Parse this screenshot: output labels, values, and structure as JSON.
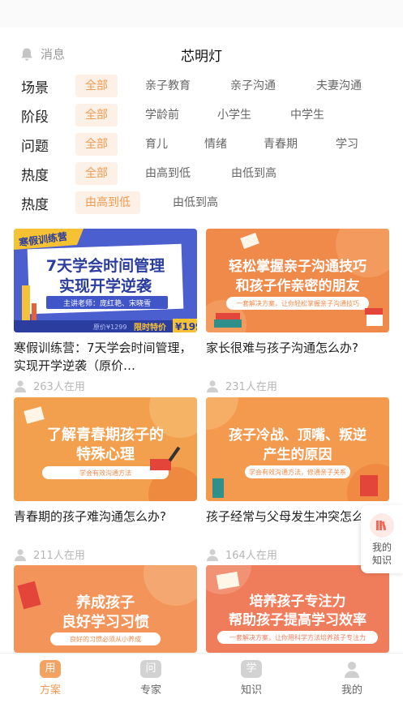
{
  "header": {
    "message_label": "消息",
    "title": "芯明灯"
  },
  "filters": {
    "scene": {
      "label": "场景",
      "options": [
        "全部",
        "亲子教育",
        "亲子沟通",
        "夫妻沟通"
      ]
    },
    "stage": {
      "label": "阶段",
      "options": [
        "全部",
        "学龄前",
        "小学生",
        "中学生"
      ]
    },
    "problem": {
      "label": "问题",
      "options": [
        "全部",
        "育儿",
        "情绪",
        "青春期",
        "学习"
      ]
    },
    "heat": {
      "label": "热度",
      "options": [
        "全部",
        "由高到低",
        "由低到高"
      ]
    },
    "heat2": {
      "label": "热度",
      "options": [
        "由高到低",
        "由低到高"
      ]
    }
  },
  "cards": [
    {
      "title": "寒假训练营：7天学会时间管理，实现开学逆袭（原价…",
      "users": "263人在用",
      "banner": {
        "corner": "寒假训练营",
        "line1": "7天学会时间管理",
        "line2": "实现开学逆袭",
        "teacher": "主讲老师：庞红艳、宋晓雪",
        "price_old": "原价¥1299",
        "price_label": "限时特价",
        "price": "¥199"
      }
    },
    {
      "title": "家长很难与孩子沟通怎么办?",
      "users": "231人在用",
      "banner": {
        "line1": "轻松掌握亲子沟通技巧",
        "line2": "和孩子作亲密的朋友",
        "sub": "一套解决方案，让你轻松掌握亲子沟通技巧"
      }
    },
    {
      "title": "青春期的孩子难沟通怎么办?",
      "users": "211人在用",
      "banner": {
        "line1": "了解青春期孩子的",
        "line2": "特殊心理",
        "sub": "学会有效沟通方法"
      }
    },
    {
      "title": "孩子经常与父母发生冲突怎么办?",
      "users": "164人在用",
      "banner": {
        "line1": "孩子冷战、顶嘴、叛逆",
        "line2": "产生的原因",
        "sub": "学会有效沟通方法，修通亲子关系"
      }
    },
    {
      "banner": {
        "line1": "养成孩子",
        "line2": "良好学习习惯",
        "sub": "良好的习惯必须从小养成"
      }
    },
    {
      "banner": {
        "line1": "培养孩子专注力",
        "line2": "帮助孩子提高学习效率",
        "sub": "一套解决方案，让你用科学方法培养孩子专注力"
      }
    }
  ],
  "knowledge_button": {
    "line1": "我的",
    "line2": "知识"
  },
  "tabbar": [
    {
      "icon_char": "用",
      "label": "方案"
    },
    {
      "icon_char": "问",
      "label": "专家"
    },
    {
      "icon_char": "学",
      "label": "知识"
    },
    {
      "icon_char": "",
      "label": "我的"
    }
  ],
  "colors": {
    "accent": "#f09a52",
    "selected_bg": "#fdf1e7",
    "muted": "#b5b5b5"
  }
}
